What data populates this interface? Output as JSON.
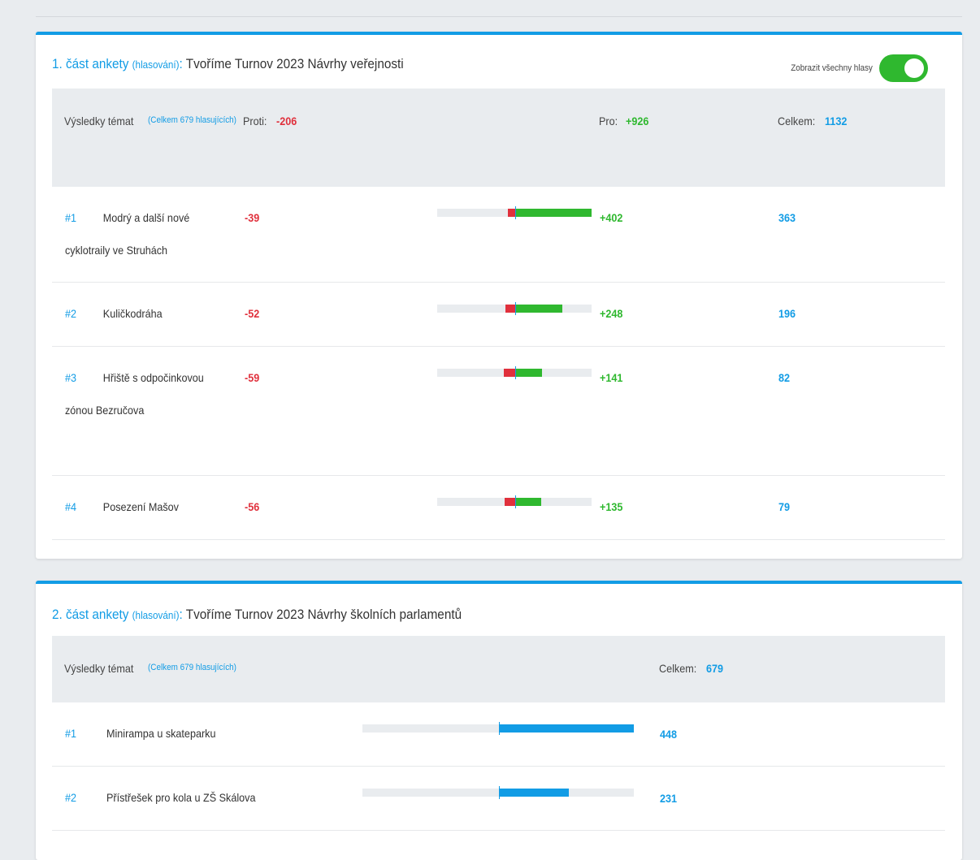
{
  "section1": {
    "title_prefix": "1. část ankety",
    "title_sub": "(hlasování)",
    "title_colon": ":",
    "title_text": "Tvoříme Turnov 2023 Návrhy veřejnosti",
    "toggle_label": "Zobrazit všechny hlasy",
    "toggle_on": true,
    "header": {
      "results_label": "Výsledky témat",
      "voters_note": "(Celkem 679 hlasujících)",
      "against_label": "Proti:",
      "against_value": "-206",
      "for_label": "Pro:",
      "for_value": "+926",
      "total_label": "Celkem:",
      "total_value": "1132"
    },
    "rows": [
      {
        "rank": "#1",
        "name": "Modrý a další nové cyklotraily ve Struhách",
        "against": "-39",
        "for": "+402",
        "total": "363",
        "against_n": 39,
        "for_n": 402
      },
      {
        "rank": "#2",
        "name": "Kuličkodráha",
        "against": "-52",
        "for": "+248",
        "total": "196",
        "against_n": 52,
        "for_n": 248
      },
      {
        "rank": "#3",
        "name": "Hřiště s odpočinkovou zónou Bezručova",
        "against": "-59",
        "for": "+141",
        "total": "82",
        "against_n": 59,
        "for_n": 141
      },
      {
        "rank": "#4",
        "name": "Posezení Mašov",
        "against": "-56",
        "for": "+135",
        "total": "79",
        "against_n": 56,
        "for_n": 135
      }
    ]
  },
  "section2": {
    "title_prefix": "2. část ankety",
    "title_sub": "(hlasování)",
    "title_colon": ":",
    "title_text": "Tvoříme Turnov 2023 Návrhy školních parlamentů",
    "header": {
      "results_label": "Výsledky témat",
      "voters_note": "(Celkem 679 hlasujících)",
      "total_label": "Celkem:",
      "total_value": "679"
    },
    "rows": [
      {
        "rank": "#1",
        "name": "Minirampa u skateparku",
        "total": "448",
        "value_n": 448
      },
      {
        "rank": "#2",
        "name": "Přístřešek pro kola u ZŠ Skálova",
        "total": "231",
        "value_n": 231
      }
    ]
  },
  "colors": {
    "accent": "#129ce5",
    "positive": "#2fb82f",
    "negative": "#e0303c"
  }
}
